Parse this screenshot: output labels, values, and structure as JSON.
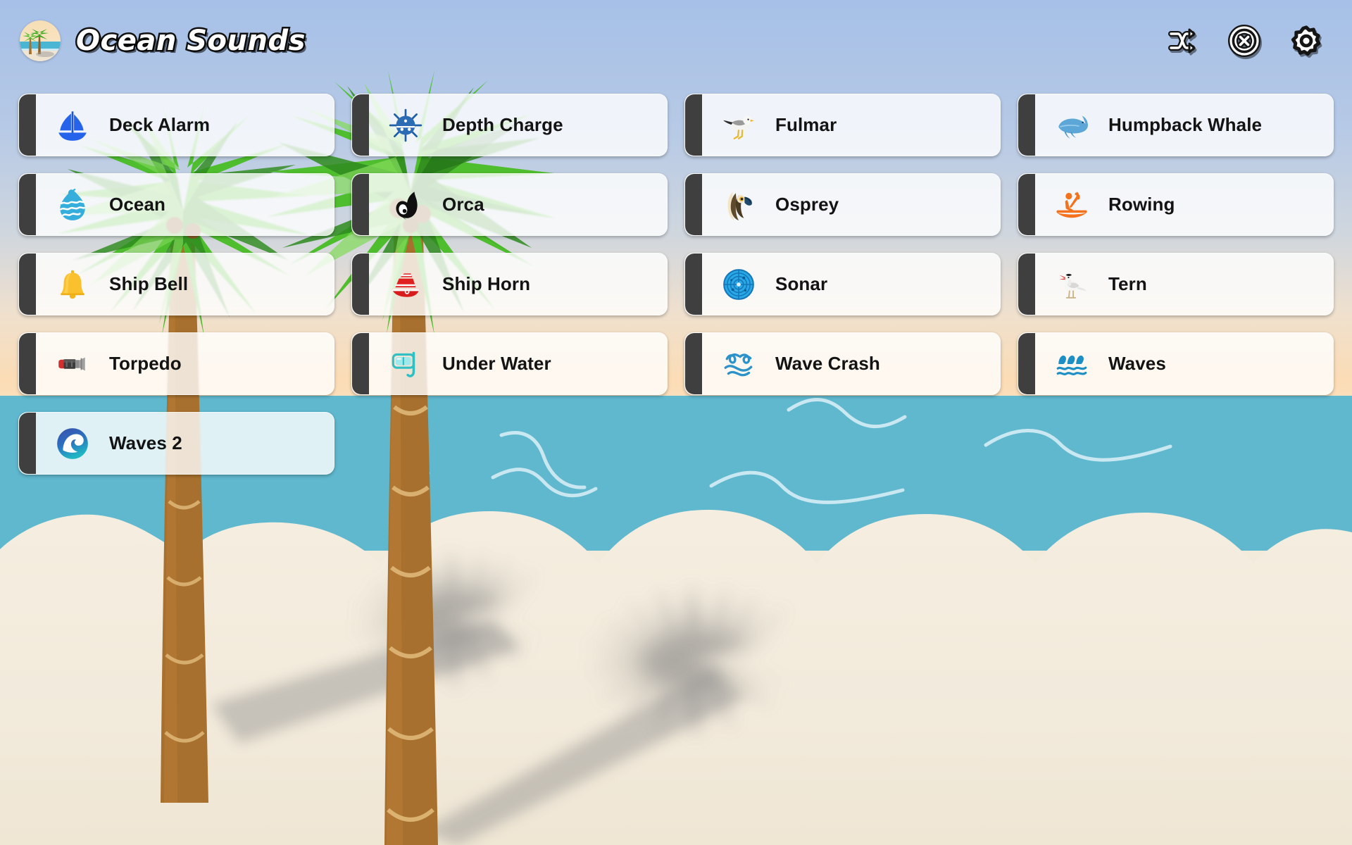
{
  "app": {
    "title": "Ocean Sounds",
    "logo_icon": "beach-palm-logo-icon"
  },
  "header": {
    "actions": [
      {
        "name": "shuffle-button",
        "icon": "shuffle-icon",
        "label": "Shuffle"
      },
      {
        "name": "stop-all-button",
        "icon": "stop-circle-x-icon",
        "label": "Stop All"
      },
      {
        "name": "settings-button",
        "icon": "gear-icon",
        "label": "Settings"
      }
    ]
  },
  "sounds": [
    {
      "label": "Deck Alarm",
      "icon": "sailboat-icon",
      "accent": "#2563EB"
    },
    {
      "label": "Depth Charge",
      "icon": "naval-mine-icon",
      "accent": "#1F5FA8"
    },
    {
      "label": "Fulmar",
      "icon": "seagull-bird-icon",
      "accent": "#8A8A8A"
    },
    {
      "label": "Humpback Whale",
      "icon": "whale-icon",
      "accent": "#5CA7D8"
    },
    {
      "label": "Ocean",
      "icon": "water-wave-icon",
      "accent": "#35AEDC"
    },
    {
      "label": "Orca",
      "icon": "orca-silhouette-icon",
      "accent": "#111111"
    },
    {
      "label": "Osprey",
      "icon": "osprey-head-icon",
      "accent": "#6B5B3E"
    },
    {
      "label": "Rowing",
      "icon": "rowing-kayak-icon",
      "accent": "#F5721C"
    },
    {
      "label": "Ship Bell",
      "icon": "bell-icon",
      "accent": "#FBC02D"
    },
    {
      "label": "Ship Horn",
      "icon": "cruise-ship-icon",
      "accent": "#D81B1B"
    },
    {
      "label": "Sonar",
      "icon": "sonar-radar-icon",
      "accent": "#29A8E8"
    },
    {
      "label": "Tern",
      "icon": "tern-bird-icon",
      "accent": "#C9C9C9"
    },
    {
      "label": "Torpedo",
      "icon": "torpedo-icon",
      "accent": "#D32F2F"
    },
    {
      "label": "Under Water",
      "icon": "snorkel-mask-icon",
      "accent": "#2FC0C4"
    },
    {
      "label": "Wave Crash",
      "icon": "wave-squiggle-icon",
      "accent": "#2B93C9"
    },
    {
      "label": "Waves",
      "icon": "triple-wave-icon",
      "accent": "#1E8FC4"
    },
    {
      "label": "Waves 2",
      "icon": "wave-circle-icon",
      "accent": "#2F4FA8"
    }
  ],
  "scene": {
    "sky_top_color": "#A8C1E6",
    "sky_bottom_color": "#FBDCB5",
    "ocean_color": "#5FB8CE",
    "sand_color": "#F2EADB",
    "palm_trunk_color": "#A8702E",
    "palm_frond_color": "#4FBE2E",
    "shadow_color": "#7A7A7A"
  }
}
